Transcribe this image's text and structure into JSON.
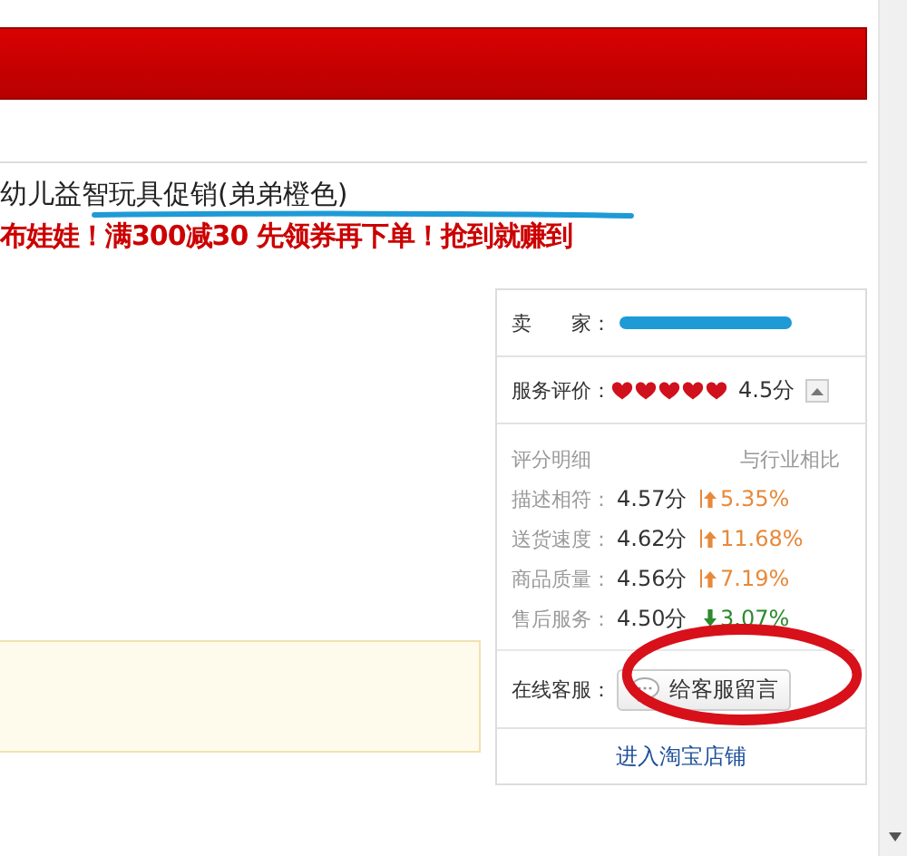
{
  "product": {
    "title": "幼儿益智玩具促销(弟弟橙色)",
    "promo": "布娃娃！满300减30 先领券再下单！抢到就赚到"
  },
  "shop_card": {
    "seller_label": "卖　　家：",
    "rating_label": "服务评价：",
    "stars": 5,
    "rating": "4.5分",
    "detail_header": "评分明细",
    "compare_header": "与行业相比",
    "scores": [
      {
        "label": "描述相符：",
        "score": "4.57分",
        "kind": "up",
        "change": "5.35%"
      },
      {
        "label": "送货速度：",
        "score": "4.62分",
        "kind": "up",
        "change": "11.68%"
      },
      {
        "label": "商品质量：",
        "score": "4.56分",
        "kind": "up",
        "change": "7.19%"
      },
      {
        "label": "售后服务：",
        "score": "4.50分",
        "kind": "down",
        "change": "3.07%"
      }
    ],
    "service_label": "在线客服：",
    "message_button": "给客服留言",
    "enter_shop": "进入淘宝店铺"
  }
}
